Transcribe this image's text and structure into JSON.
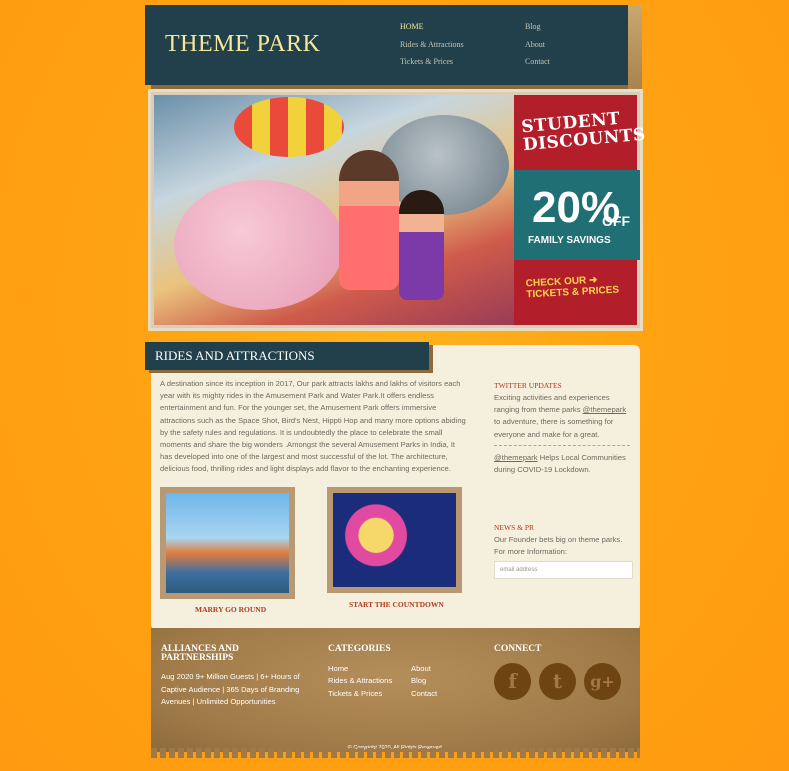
{
  "site": {
    "logo": "THEME PARK"
  },
  "nav": {
    "home": "HOME",
    "rides": "Rides & Attractions",
    "tickets": "Tickets & Prices",
    "blog": "Blog",
    "about": "About",
    "contact": "Contact"
  },
  "promo": {
    "line1": "STUDENT",
    "line2": "DISCOUNTS",
    "percent": "20%",
    "off": "OFF",
    "family": "FAMILY SAVINGS",
    "cta1": "CHECK OUR",
    "cta2": "TICKETS & PRICES"
  },
  "main": {
    "section_title": "RIDES AND ATTRACTIONS",
    "intro": "A destination since its inception in 2017, Our park attracts lakhs and lakhs of visitors each year with its mighty rides in the Amusement Park and Water Park.It offers endless entertainment and fun. For the younger set, the Amusement Park offers immersive attractions such as the Space Shot, Bird's Nest, Hippti Hop and many more options abiding by the safety rules and regulations. It is undoubtedly the place to celebrate the small moments and share the big wonders .Amongst the several Amusement Parks in India, It has developed into one of the largest and most successful of the lot. The architecture, delicious food, thrilling rides and light displays add flavor to the enchanting experience.",
    "thumbs": [
      {
        "caption": "MARRY GO ROUND"
      },
      {
        "caption": "START THE COUNTDOWN"
      }
    ]
  },
  "sidebar": {
    "twitter_title": "TWITTER UPDATES",
    "tweet1_a": "Exciting activities and experiences ranging from theme parks ",
    "tweet1_handle": "@themepark",
    "tweet1_b": " to adventure, there is something for everyone and make for a great.",
    "tweet2_handle": "@themepark",
    "tweet2_b": " Helps Local Communities during COVID-19 Lockdown.",
    "news_title": "NEWS & PR",
    "news_text": "Our Founder bets big on theme parks. For more Information:",
    "email_placeholder": "email address"
  },
  "footer": {
    "alliances_title1": "ALLIANCES AND",
    "alliances_title2": "PARTNERSHIPS",
    "alliances_text": "Aug 2020 9+ Million Guests | 6+ Hours of Captive Audience | 365 Days of Branding Avenues | Unlimited Opportunities",
    "categories_title": "CATEGORIES",
    "cat_home": "Home",
    "cat_rides": "Rides & Attractions",
    "cat_tickets": "Tickets & Prices",
    "cat_about": "About",
    "cat_blog": "Blog",
    "cat_contact": "Contact",
    "connect_title": "CONNECT",
    "social": {
      "facebook": "f",
      "twitter": "t",
      "google": "g+"
    },
    "copyright": "© Copyright 2020. All Rights Reserved."
  },
  "colors": {
    "background": "#ffa312",
    "header": "#21404b",
    "accent_text": "#f6e79a",
    "link_red": "#b33a1e",
    "card": "#f5efdd"
  }
}
